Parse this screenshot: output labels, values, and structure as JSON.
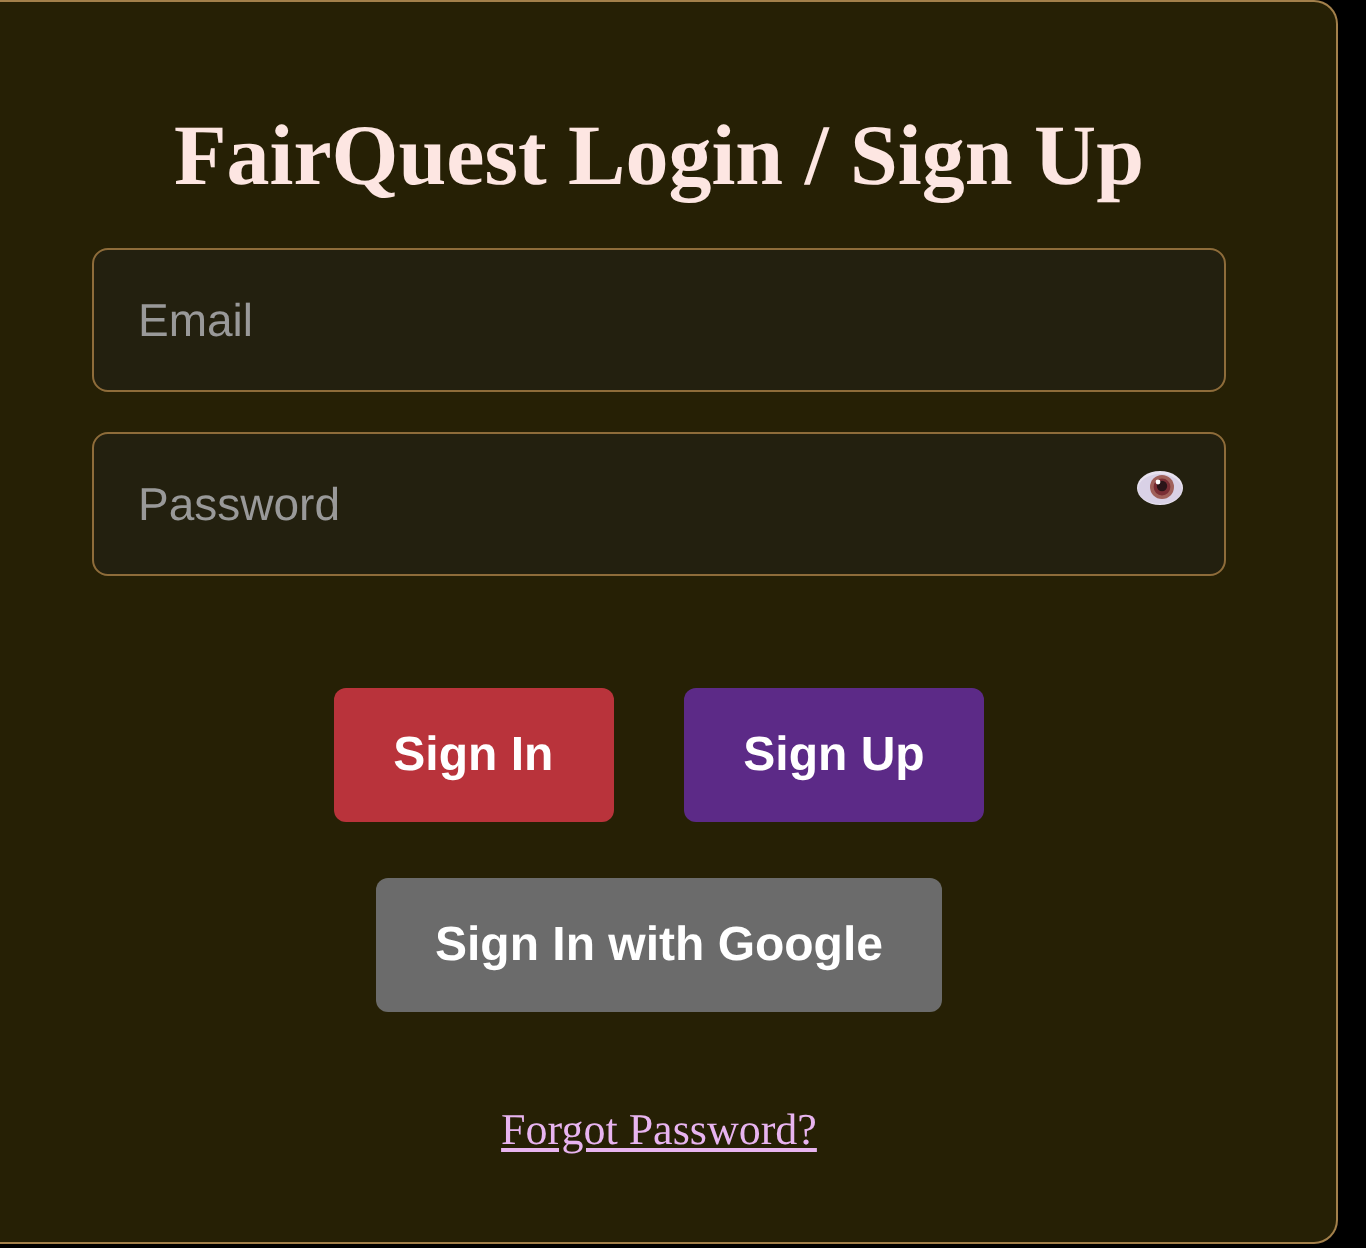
{
  "title": "FairQuest Login / Sign Up",
  "fields": [
    {
      "kind": "email",
      "placeholder": "Email"
    },
    {
      "kind": "password",
      "placeholder": "Password"
    }
  ],
  "button_rows": [
    {
      "buttons": [
        {
          "label": "Sign In",
          "color": "#b9333b"
        },
        {
          "label": "Sign Up",
          "color": "#5c2a87"
        }
      ]
    },
    {
      "buttons": [
        {
          "label": "Sign In with Google",
          "color": "#6b6b6b"
        }
      ]
    }
  ],
  "forgot_link": "Forgot Password?"
}
